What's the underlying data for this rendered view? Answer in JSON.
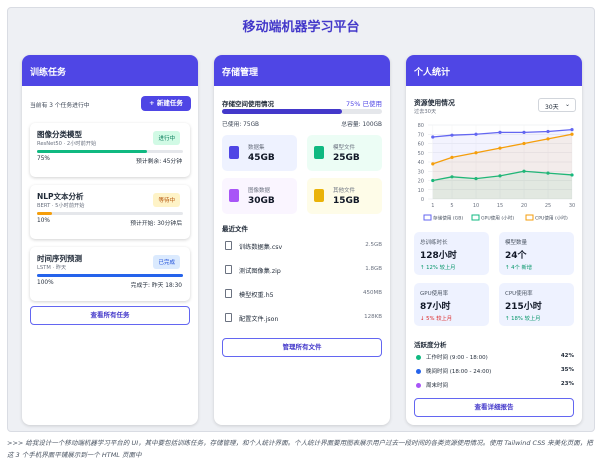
{
  "title": "移动端机器学习平台",
  "colors": {
    "primary": "#4f46e5",
    "green": "#10b981",
    "orange": "#f59e0b",
    "blue": "#2563eb",
    "purple": "#a855f7"
  },
  "training": {
    "header": "训练任务",
    "summary": "当前有 3 个任务进行中",
    "new_button": "+ 新建任务",
    "tasks": [
      {
        "name": "图像分类模型",
        "sub": "ResNet50 · 2小时前开始",
        "badge": "进行中",
        "percent": "75%",
        "eta": "预计剩余: 45分钟",
        "progress": 0.75
      },
      {
        "name": "NLP文本分析",
        "sub": "BERT · 5小时前开始",
        "badge": "等待中",
        "percent": "10%",
        "eta": "预计开始: 30分钟后",
        "progress": 0.1
      },
      {
        "name": "时间序列预测",
        "sub": "LSTM · 昨天",
        "badge": "已完成",
        "percent": "100%",
        "eta": "完成于: 昨天 18:30",
        "progress": 1.0
      }
    ],
    "view_all": "查看所有任务"
  },
  "storage": {
    "header": "存储管理",
    "usage_title": "存储空间使用情况",
    "usage_pct": "75% 已使用",
    "usage_fraction": 0.75,
    "used": "已使用: 75GB",
    "total": "总容量: 100GB",
    "tiles": [
      {
        "label": "数据集",
        "value": "45GB",
        "icon": "dataset-icon"
      },
      {
        "label": "模型文件",
        "value": "25GB",
        "icon": "model-icon"
      },
      {
        "label": "图像数据",
        "value": "30GB",
        "icon": "image-icon"
      },
      {
        "label": "其他文件",
        "value": "15GB",
        "icon": "file-icon"
      }
    ],
    "recent_title": "最近文件",
    "files": [
      {
        "name": "训练数据集.csv",
        "size": "2.5GB"
      },
      {
        "name": "测试图像集.zip",
        "size": "1.8GB"
      },
      {
        "name": "模型权重.h5",
        "size": "450MB"
      },
      {
        "name": "配置文件.json",
        "size": "128KB"
      }
    ],
    "manage_button": "管理所有文件"
  },
  "stats": {
    "header": "个人统计",
    "usage_title": "资源使用情况",
    "usage_subtitle": "过去30天",
    "range_select": "30天",
    "stats_cards": [
      {
        "label": "总训练时长",
        "value": "128小时",
        "trend": "↑ 12% 较上月",
        "trend_dir": "up"
      },
      {
        "label": "模型数量",
        "value": "24个",
        "trend": "↑ 4个 新增",
        "trend_dir": "up"
      },
      {
        "label": "GPU使用率",
        "value": "87小时",
        "trend": "↓ 5% 较上月",
        "trend_dir": "down"
      },
      {
        "label": "CPU使用率",
        "value": "215小时",
        "trend": "↑ 18% 较上月",
        "trend_dir": "up"
      }
    ],
    "activity_title": "活跃度分析",
    "activity": [
      {
        "label": "工作时间 (9:00 - 18:00)",
        "pct": "42%",
        "color": "#10b981"
      },
      {
        "label": "晚间时间 (18:00 - 24:00)",
        "pct": "35%",
        "color": "#2563eb"
      },
      {
        "label": "周末时间",
        "pct": "23%",
        "color": "#a855f7"
      }
    ],
    "details_button": "查看详细报告"
  },
  "chart_data": {
    "type": "line",
    "x": [
      1,
      5,
      10,
      15,
      20,
      25,
      30
    ],
    "ylim": [
      0,
      80
    ],
    "yticks": [
      "0",
      "10",
      "20",
      "30",
      "40",
      "50",
      "60",
      "70",
      "80"
    ],
    "xticks": [
      "1",
      "5",
      "10",
      "15",
      "20",
      "25",
      "30"
    ],
    "grid": true,
    "legend": "bottom",
    "series": [
      {
        "name": "存储使用 (GB)",
        "color": "#6366f1",
        "values": [
          67,
          69,
          70,
          72,
          72,
          73,
          75
        ]
      },
      {
        "name": "GPU使用 (小时)",
        "color": "#10b981",
        "values": [
          20,
          24,
          22,
          25,
          30,
          28,
          26
        ]
      },
      {
        "name": "CPU使用 (小时)",
        "color": "#f59e0b",
        "values": [
          38,
          45,
          50,
          55,
          60,
          65,
          70
        ]
      }
    ]
  },
  "caption": ">>> 给我设计一个移动端机器学习平台的 UI，其中要包括训练任务，存储管理，和个人统计界面。个人统计界面要用图表展示用户过去一段时间的各类资源使用情况。使用 Tailwind CSS 来美化页面，把这 3 个手机界面平铺展示到一个 HTML 页面中"
}
